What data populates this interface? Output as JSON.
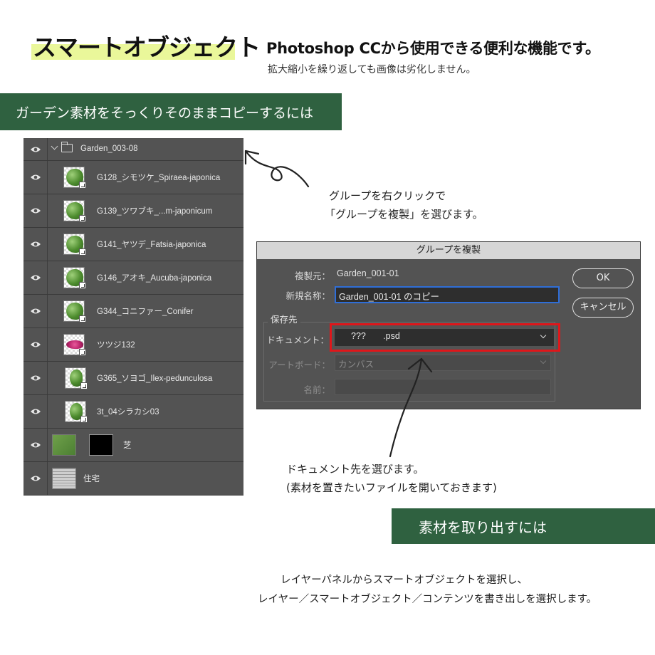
{
  "header": {
    "title": "スマートオブジェクト",
    "subtitle": "Photoshop CCから使用できる便利な機能です。",
    "subnote": "拡大縮小を繰り返しても画像は劣化しません。"
  },
  "section1_banner": "ガーデン素材をそっくりそのままコピーするには",
  "layers_panel": {
    "group_name": "Garden_003-08",
    "layers": [
      {
        "name": "G128_シモツケ_Spiraea-japonica",
        "icon": "plant-thumbnail"
      },
      {
        "name": "G139_ツワブキ_...m-japonicum",
        "icon": "plant-thumbnail"
      },
      {
        "name": "G141_ヤツデ_Fatsia-japonica",
        "icon": "plant-thumbnail"
      },
      {
        "name": "G146_アオキ_Aucuba-japonica",
        "icon": "plant-thumbnail"
      },
      {
        "name": "G344_コニファー_Conifer",
        "icon": "plant-thumbnail"
      },
      {
        "name": "ツツジ132",
        "icon": "flower-thumbnail"
      },
      {
        "name": "G365_ソヨゴ_Ilex-pedunculosa",
        "icon": "tree-thumbnail"
      },
      {
        "name": "3t_04シラカシ03",
        "icon": "tree-thumbnail"
      },
      {
        "name": "芝",
        "icon": "grass-thumbnail"
      },
      {
        "name": "住宅",
        "icon": "house-thumbnail"
      }
    ]
  },
  "note1": {
    "line1": "グループを右クリックで",
    "line2": "「グループを複製」を選びます。"
  },
  "dialog": {
    "title": "グループを複製",
    "source_label": "複製元：",
    "source_value": "Garden_001-01",
    "newname_label": "新規名称：",
    "newname_value": "Garden_001-01 のコピー",
    "destination_heading": "保存先",
    "document_label": "ドキュメント：",
    "document_value": "???       .psd",
    "artboard_label": "アートボード：",
    "artboard_value": "カンバス",
    "name_label": "名前：",
    "ok_label": "OK",
    "cancel_label": "キャンセル"
  },
  "note2": {
    "line1": "ドキュメント先を選びます。",
    "line2": "(素材を置きたいファイルを開いておきます)"
  },
  "section2_banner": "素材を取り出すには",
  "bottom_text": {
    "line1": "レイヤーパネルからスマートオブジェクトを選択し、",
    "line2": "レイヤー／スマートオブジェクト／コンテンツを書き出しを選択します。"
  },
  "colors": {
    "banner_green": "#2f6140",
    "title_highlight": "#eaf79a",
    "panel_gray": "#535353",
    "highlight_red": "#e0161a",
    "focus_blue": "#2f6ed8"
  }
}
